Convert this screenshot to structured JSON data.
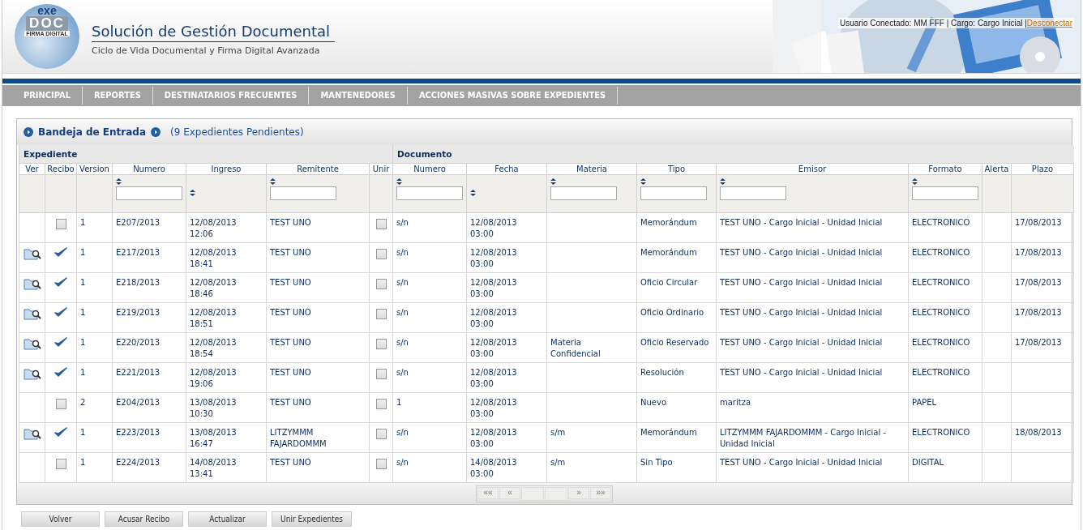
{
  "header": {
    "logo": {
      "top": "exe",
      "middle": "DOC",
      "bottom": "FIRMA DIGITAL"
    },
    "title": "Solución de Gestión Documental",
    "subtitle": "Ciclo de Vida Documental y Firma Digital Avanzada",
    "user_info": "Usuario Conectado: MM FFF | Cargo: Cargo Inicial |",
    "logout_link": "Desconectar"
  },
  "nav": [
    "PRINCIPAL",
    "REPORTES",
    "DESTINATARIOS FRECUENTES",
    "MANTENEDORES",
    "ACCIONES MASIVAS SOBRE EXPEDIENTES"
  ],
  "panel": {
    "title": "Bandeja de Entrada",
    "count": "(9 Expedientes Pendientes)"
  },
  "table": {
    "groups": [
      {
        "label": "Expediente"
      },
      {
        "label": "Documento"
      }
    ],
    "columns": [
      {
        "label": "Ver",
        "kind": "plain"
      },
      {
        "label": "Recibo",
        "kind": "plain"
      },
      {
        "label": "Version",
        "kind": "plain"
      },
      {
        "label": "Numero",
        "kind": "filter"
      },
      {
        "label": "Ingreso",
        "kind": "sort"
      },
      {
        "label": "Remitente",
        "kind": "filter"
      },
      {
        "label": "Unir",
        "kind": "plain"
      },
      {
        "label": "Numero",
        "kind": "filter"
      },
      {
        "label": "Fecha",
        "kind": "sort"
      },
      {
        "label": "Materia",
        "kind": "filter"
      },
      {
        "label": "Tipo",
        "kind": "filter"
      },
      {
        "label": "Emisor",
        "kind": "filter"
      },
      {
        "label": "Formato",
        "kind": "filter"
      },
      {
        "label": "Alerta",
        "kind": "plain"
      },
      {
        "label": "Plazo",
        "kind": "plain"
      }
    ],
    "rows": [
      {
        "viewable": false,
        "received": false,
        "version": "1",
        "numero": "E207/2013",
        "ingreso": "12/08/2013 12:06",
        "remitente": "TEST UNO",
        "unir": false,
        "doc_numero": "s/n",
        "fecha": "12/08/2013 03:00",
        "tipo": "Memorándum",
        "emisor": "TEST UNO - Cargo Inicial - Unidad Inicial",
        "formato": "ELECTRONICO",
        "plazo": "17/08/2013"
      },
      {
        "viewable": true,
        "received": true,
        "version": "1",
        "numero": "E217/2013",
        "ingreso": "12/08/2013 18:41",
        "remitente": "TEST UNO",
        "unir": false,
        "doc_numero": "s/n",
        "fecha": "12/08/2013 03:00",
        "tipo": "Memorándum",
        "emisor": "TEST UNO - Cargo Inicial - Unidad Inicial",
        "formato": "ELECTRONICO",
        "plazo": "17/08/2013"
      },
      {
        "viewable": true,
        "received": true,
        "version": "1",
        "numero": "E218/2013",
        "ingreso": "12/08/2013 18:46",
        "remitente": "TEST UNO",
        "unir": false,
        "doc_numero": "s/n",
        "fecha": "12/08/2013 03:00",
        "tipo": "Oficio Circular",
        "emisor": "TEST UNO - Cargo Inicial - Unidad Inicial",
        "formato": "ELECTRONICO",
        "plazo": "17/08/2013"
      },
      {
        "viewable": true,
        "received": true,
        "version": "1",
        "numero": "E219/2013",
        "ingreso": "12/08/2013 18:51",
        "remitente": "TEST UNO",
        "unir": false,
        "doc_numero": "s/n",
        "fecha": "12/08/2013 03:00",
        "tipo": "Oficio Ordinario",
        "emisor": "TEST UNO - Cargo Inicial - Unidad Inicial",
        "formato": "ELECTRONICO",
        "plazo": "17/08/2013"
      },
      {
        "viewable": true,
        "received": true,
        "version": "1",
        "numero": "E220/2013",
        "ingreso": "12/08/2013 18:54",
        "remitente": "TEST UNO",
        "unir": false,
        "doc_numero": "s/n",
        "fecha": "12/08/2013 03:00",
        "materia": "Materia Confidencial",
        "tipo": "Oficio Reservado",
        "emisor": "TEST UNO - Cargo Inicial - Unidad Inicial",
        "formato": "ELECTRONICO",
        "plazo": "17/08/2013"
      },
      {
        "viewable": true,
        "received": true,
        "version": "1",
        "numero": "E221/2013",
        "ingreso": "12/08/2013 19:06",
        "remitente": "TEST UNO",
        "unir": false,
        "doc_numero": "s/n",
        "fecha": "12/08/2013 03:00",
        "tipo": "Resolución",
        "emisor": "TEST UNO - Cargo Inicial - Unidad Inicial",
        "formato": "ELECTRONICO"
      },
      {
        "viewable": false,
        "received": false,
        "version": "2",
        "numero": "E204/2013",
        "ingreso": "13/08/2013 10:30",
        "remitente": "TEST UNO",
        "unir": false,
        "doc_numero": "1",
        "fecha": "12/08/2013 03:00",
        "tipo": "Nuevo",
        "emisor": "maritza",
        "formato": "PAPEL"
      },
      {
        "viewable": true,
        "received": true,
        "version": "1",
        "numero": "E223/2013",
        "ingreso": "13/08/2013 16:47",
        "remitente": "LITZYMMM FAJARDOMMM",
        "unir": false,
        "doc_numero": "s/n",
        "fecha": "12/08/2013 03:00",
        "materia": "s/m",
        "tipo": "Memorándum",
        "emisor": "LITZYMMM FAJARDOMMM - Cargo Inicial - Unidad Inicial",
        "formato": "ELECTRONICO",
        "plazo": "18/08/2013"
      },
      {
        "viewable": false,
        "received": false,
        "version": "1",
        "numero": "E224/2013",
        "ingreso": "14/08/2013 13:41",
        "remitente": "TEST UNO",
        "unir": false,
        "doc_numero": "s/n",
        "fecha": "14/08/2013 03:00",
        "materia": "s/m",
        "tipo": "Sin Tipo",
        "emisor": "TEST UNO - Cargo Inicial - Unidad Inicial",
        "formato": "DIGITAL"
      }
    ]
  },
  "pager": {
    "first": "««",
    "prev": "«",
    "next": "»",
    "last": "»»",
    "disabled": true
  },
  "buttons": [
    "Volver",
    "Acusar Recibo",
    "Actualizar",
    "Unir Expedientes"
  ]
}
